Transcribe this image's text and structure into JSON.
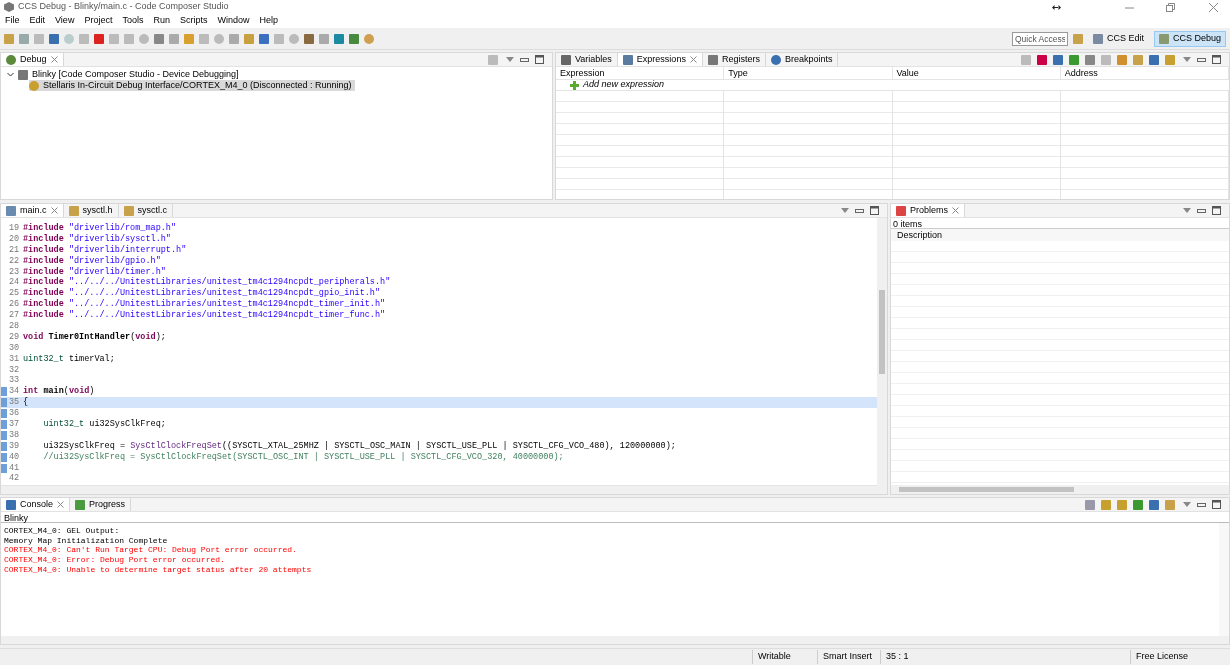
{
  "window": {
    "title": "CCS Debug - Blinky/main.c - Code Composer Studio"
  },
  "menu": [
    "File",
    "Edit",
    "View",
    "Project",
    "Tools",
    "Run",
    "Scripts",
    "Window",
    "Help"
  ],
  "toolbar": {
    "quick_access": {
      "placeholder": "Quick Access"
    },
    "perspectives": [
      {
        "label": "CCS Edit",
        "selected": false
      },
      {
        "label": "CCS Debug",
        "selected": true
      }
    ]
  },
  "debug_view": {
    "tab": "Debug",
    "tree": [
      {
        "label": "Blinky [Code Composer Studio - Device Debugging]",
        "expanded": true,
        "selected": false,
        "children": [
          {
            "label": "Stellaris In-Circuit Debug Interface/CORTEX_M4_0 (Disconnected : Running)",
            "selected": true
          }
        ]
      }
    ]
  },
  "expressions_view": {
    "tabs": [
      {
        "label": "Variables",
        "selected": false
      },
      {
        "label": "Expressions",
        "selected": true
      },
      {
        "label": "Registers",
        "selected": false
      },
      {
        "label": "Breakpoints",
        "selected": false
      }
    ],
    "columns": [
      "Expression",
      "Type",
      "Value",
      "Address"
    ],
    "add_row": "Add new expression"
  },
  "editor": {
    "tabs": [
      {
        "label": "main.c",
        "selected": true
      },
      {
        "label": "sysctl.h",
        "selected": false
      },
      {
        "label": "sysctl.c",
        "selected": false
      }
    ],
    "lines": [
      {
        "number": "19",
        "marked": false,
        "current": false,
        "tokens": [
          {
            "kind": "keyword",
            "text": "#include"
          },
          {
            "kind": "string",
            "text": " \"driverlib/rom_map.h\""
          }
        ]
      },
      {
        "number": "20",
        "marked": false,
        "current": false,
        "tokens": [
          {
            "kind": "keyword",
            "text": "#include"
          },
          {
            "kind": "string",
            "text": " \"driverlib/sysctl.h\""
          }
        ]
      },
      {
        "number": "21",
        "marked": false,
        "current": false,
        "tokens": [
          {
            "kind": "keyword",
            "text": "#include"
          },
          {
            "kind": "string",
            "text": " \"driverlib/interrupt.h\""
          }
        ]
      },
      {
        "number": "22",
        "marked": false,
        "current": false,
        "tokens": [
          {
            "kind": "keyword",
            "text": "#include"
          },
          {
            "kind": "string",
            "text": " \"driverlib/gpio.h\""
          }
        ]
      },
      {
        "number": "23",
        "marked": false,
        "current": false,
        "tokens": [
          {
            "kind": "keyword",
            "text": "#include"
          },
          {
            "kind": "string",
            "text": " \"driverlib/timer.h\""
          }
        ]
      },
      {
        "number": "24",
        "marked": false,
        "current": false,
        "tokens": [
          {
            "kind": "keyword",
            "text": "#include"
          },
          {
            "kind": "string",
            "text": " \"../../../UnitestLibraries/unitest_tm4c1294ncpdt_peripherals.h\""
          }
        ]
      },
      {
        "number": "25",
        "marked": false,
        "current": false,
        "tokens": [
          {
            "kind": "keyword",
            "text": "#include"
          },
          {
            "kind": "string",
            "text": " \"../../../UnitestLibraries/unitest_tm4c1294ncpdt_gpio_init.h\""
          }
        ]
      },
      {
        "number": "26",
        "marked": false,
        "current": false,
        "tokens": [
          {
            "kind": "keyword",
            "text": "#include"
          },
          {
            "kind": "string",
            "text": " \"../../../UnitestLibraries/unitest_tm4c1294ncpdt_timer_init.h\""
          }
        ]
      },
      {
        "number": "27",
        "marked": false,
        "current": false,
        "tokens": [
          {
            "kind": "keyword",
            "text": "#include"
          },
          {
            "kind": "string",
            "text": " \"../../../UnitestLibraries/unitest_tm4c1294ncpdt_timer_func.h\""
          }
        ]
      },
      {
        "number": "28",
        "marked": false,
        "current": false
      },
      {
        "number": "29",
        "marked": false,
        "current": false,
        "tokens": [
          {
            "kind": "keyword",
            "text": "void"
          },
          {
            "kind": "bold",
            "text": " Timer0IntHandler"
          },
          {
            "kind": "plain",
            "text": "("
          },
          {
            "kind": "keyword",
            "text": "void"
          },
          {
            "kind": "plain",
            "text": ");"
          }
        ]
      },
      {
        "number": "30",
        "marked": false,
        "current": false
      },
      {
        "number": "31",
        "marked": false,
        "current": false,
        "tokens": [
          {
            "kind": "type",
            "text": "uint32_t"
          },
          {
            "kind": "plain",
            "text": " timerVal;"
          }
        ]
      },
      {
        "number": "32",
        "marked": false,
        "current": false
      },
      {
        "number": "33",
        "marked": false,
        "current": false
      },
      {
        "number": "34",
        "marked": true,
        "current": false,
        "tokens": [
          {
            "kind": "keyword",
            "text": "int"
          },
          {
            "kind": "bold",
            "text": " main"
          },
          {
            "kind": "plain",
            "text": "("
          },
          {
            "kind": "keyword",
            "text": "void"
          },
          {
            "kind": "plain",
            "text": ")"
          }
        ]
      },
      {
        "number": "35",
        "marked": true,
        "current": true,
        "tokens": [
          {
            "kind": "plain",
            "text": "{"
          }
        ]
      },
      {
        "number": "36",
        "marked": true,
        "current": false
      },
      {
        "number": "37",
        "marked": true,
        "current": false,
        "tokens": [
          {
            "kind": "type",
            "text": "    uint32_t"
          },
          {
            "kind": "plain",
            "text": " ui32SysClkFreq;"
          }
        ]
      },
      {
        "number": "38",
        "marked": true,
        "current": false
      },
      {
        "number": "39",
        "marked": true,
        "current": false,
        "tokens": [
          {
            "kind": "plain",
            "text": "    ui32SysClkFreq = "
          },
          {
            "kind": "func",
            "text": "SysCtlClockFreqSet"
          },
          {
            "kind": "plain",
            "text": "((SYSCTL_XTAL_25MHZ | SYSCTL_OSC_MAIN | SYSCTL_USE_PLL | SYSCTL_CFG_VCO_480), 120000000);"
          }
        ]
      },
      {
        "number": "40",
        "marked": true,
        "current": false,
        "tokens": [
          {
            "kind": "comment",
            "text": "    //ui32SysClkFreq = SysCtlClockFreqSet(SYSCTL_OSC_INT | SYSCTL_USE_PLL | SYSCTL_CFG_VCO_320, 40000000);"
          }
        ]
      },
      {
        "number": "41",
        "marked": true,
        "current": false
      },
      {
        "number": "42",
        "marked": false,
        "current": false
      }
    ]
  },
  "problems_view": {
    "tab": "Problems",
    "count": "0 items",
    "columns": [
      "Description"
    ]
  },
  "console_view": {
    "tabs": [
      {
        "label": "Console",
        "selected": true
      },
      {
        "label": "Progress",
        "selected": false
      }
    ],
    "name": "Blinky",
    "lines": [
      {
        "kind": "output",
        "text": "CORTEX_M4_0: GEL Output:"
      },
      {
        "kind": "output",
        "text": "Memory Map Initialization Complete"
      },
      {
        "kind": "error",
        "text": "CORTEX_M4_0: Can't Run Target CPU: Debug Port error occurred."
      },
      {
        "kind": "error",
        "text": "CORTEX_M4_0: Error: Debug Port error occurred."
      },
      {
        "kind": "error",
        "text": "CORTEX_M4_0: Unable to determine target status after 20 attempts"
      }
    ]
  },
  "status_bar": [
    "Writable",
    "Smart Insert",
    "35 : 1",
    "Free License"
  ]
}
